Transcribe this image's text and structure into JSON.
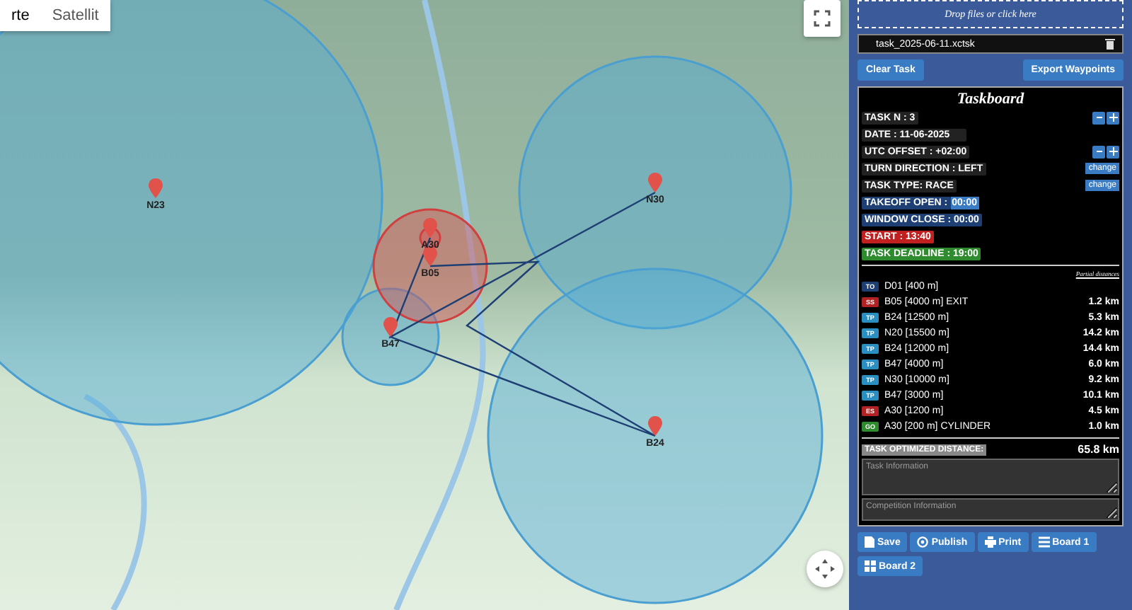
{
  "map": {
    "type_tabs": [
      {
        "label": "rte",
        "selected": true
      },
      {
        "label": "Satellit",
        "selected": false
      }
    ],
    "turnpoints": [
      {
        "label": "N23",
        "kind": "tp"
      },
      {
        "label": "A30",
        "kind": "ss"
      },
      {
        "label": "B05",
        "kind": "ss"
      },
      {
        "label": "B47",
        "kind": "tp"
      },
      {
        "label": "N30",
        "kind": "tp"
      },
      {
        "label": "B24",
        "kind": "tp"
      }
    ]
  },
  "panel": {
    "dropzone": "Drop files or click here",
    "file_name": "task_2025-06-11.xctsk",
    "clear_button": "Clear Task",
    "export_button": "Export Waypoints",
    "taskboard": {
      "title": "Taskboard",
      "info": [
        {
          "kind": "stepper",
          "label": "TASK N : 3"
        },
        {
          "kind": "plain",
          "label": "DATE : 11-06-2025"
        },
        {
          "kind": "stepper",
          "label": "UTC OFFSET : +02:00"
        },
        {
          "kind": "change",
          "label": "TURN DIRECTION : LEFT",
          "button": "change"
        },
        {
          "kind": "change",
          "label": "TASK TYPE: RACE",
          "button": "change"
        },
        {
          "kind": "time",
          "label": "TAKEOFF OPEN :",
          "value": "00:00"
        },
        {
          "kind": "time",
          "label": "WINDOW CLOSE : 00:00"
        },
        {
          "kind": "start",
          "label": "START : 13:40"
        },
        {
          "kind": "deadline",
          "label": "TASK DEADLINE : 19:00"
        }
      ],
      "partial_heading": "Partial distances",
      "turnpoints": [
        {
          "type": "TO",
          "name": "D01 [400 m]"
        },
        {
          "type": "SS",
          "name": "B05 [4000 m] EXIT",
          "distance": "1.2 km"
        },
        {
          "type": "TP",
          "name": "B24 [12500 m]",
          "distance": "5.3 km"
        },
        {
          "type": "TP",
          "name": "N20 [15500 m]",
          "distance": "14.2 km"
        },
        {
          "type": "TP",
          "name": "B24 [12000 m]",
          "distance": "14.4 km"
        },
        {
          "type": "TP",
          "name": "B47 [4000 m]",
          "distance": "6.0 km"
        },
        {
          "type": "TP",
          "name": "N30 [10000 m]",
          "distance": "9.2 km"
        },
        {
          "type": "TP",
          "name": "B47 [3000 m]",
          "distance": "10.1 km"
        },
        {
          "type": "ES",
          "name": "A30 [1200 m]",
          "distance": "4.5 km"
        },
        {
          "type": "GO",
          "name": "A30 [200 m] CYLINDER",
          "distance": "1.0 km"
        }
      ],
      "total_label": "TASK OPTIMIZED DISTANCE:",
      "total": "65.8 km",
      "task_info_placeholder": "Task Information",
      "competition_info_placeholder": "Competition Information"
    },
    "actions": [
      {
        "kind": "save",
        "label": "Save"
      },
      {
        "kind": "publish",
        "label": "Publish"
      },
      {
        "kind": "print",
        "label": "Print"
      },
      {
        "kind": "board1",
        "label": "Board 1"
      },
      {
        "kind": "board2",
        "label": "Board 2"
      }
    ]
  }
}
